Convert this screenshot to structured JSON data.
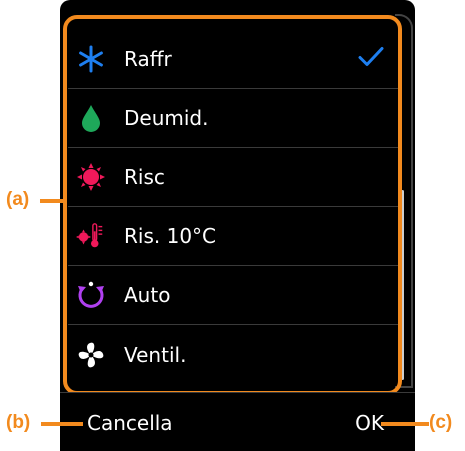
{
  "modes": [
    {
      "label": "Raffr",
      "icon": "snowflake-icon",
      "color": "#1e7ff0",
      "selected": true
    },
    {
      "label": "Deumid.",
      "icon": "water-drop-icon",
      "color": "#1ea85a",
      "selected": false
    },
    {
      "label": "Risc",
      "icon": "sun-icon",
      "color": "#f0195a",
      "selected": false
    },
    {
      "label": "Ris. 10°C",
      "icon": "thermometer-heat-icon",
      "color": "#f0195a",
      "selected": false
    },
    {
      "label": "Auto",
      "icon": "auto-cycle-icon",
      "color": "#b040f0",
      "selected": false
    },
    {
      "label": "Ventil.",
      "icon": "fan-icon",
      "color": "#ffffff",
      "selected": false
    }
  ],
  "buttons": {
    "cancel": "Cancella",
    "ok": "OK"
  },
  "callouts": {
    "a": "(a)",
    "b": "(b)",
    "c": "(c)"
  },
  "colors": {
    "highlight": "#f28a1e",
    "check": "#1e7ff0",
    "background": "#000000"
  }
}
